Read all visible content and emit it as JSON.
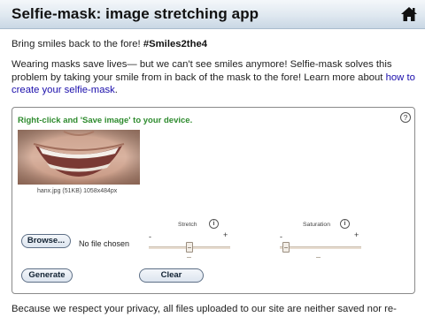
{
  "header": {
    "title": "Selfie-mask: image stretching app",
    "home_icon": "home-icon"
  },
  "intro": {
    "lead": "Bring smiles back to the fore! ",
    "hashtag": "#Smiles2the4"
  },
  "paragraph": {
    "text": "Wearing masks save lives— but we can't see smiles anymore! Selfie-mask solves this problem by taking your smile from in back of the mask to the fore! Learn more about ",
    "link": "how to create your selfie-mask",
    "end": "."
  },
  "panel": {
    "instruction": "Right-click and 'Save image' to your device.",
    "help": "?",
    "image_caption": "hanx.jpg (51KB) 1058x484px",
    "browse_label": "Browse...",
    "file_status": "No file chosen",
    "generate_label": "Generate",
    "clear_label": "Clear",
    "sliders": [
      {
        "label": "Stretch",
        "info": "i",
        "minus": "-",
        "plus": "+",
        "value": 0.5
      },
      {
        "label": "Saturation",
        "info": "i",
        "minus": "-",
        "plus": "+",
        "value": 0.03
      }
    ]
  },
  "footer": {
    "text": "Because we respect your privacy, all files uploaded to our site are neither saved nor re-"
  },
  "colors": {
    "instruction": "#2e8b2e",
    "link": "#1a0dab",
    "header_top": "#f4f7fa",
    "header_bottom": "#c9d7e4"
  }
}
